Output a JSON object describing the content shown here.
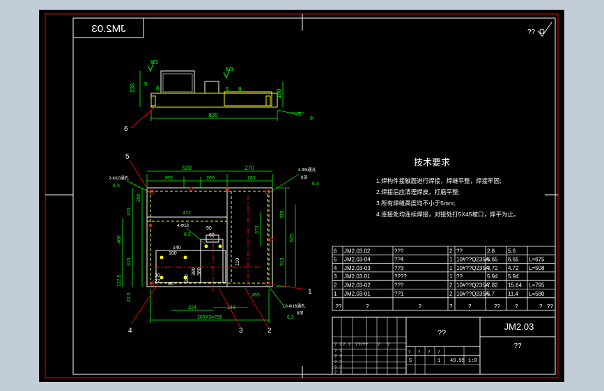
{
  "drawing_number": "JM2.03",
  "mirrored_number": "JM2.03",
  "roughness_mark": "??",
  "front_view": {
    "roughness": [
      "6.3",
      "6.3"
    ],
    "weld_marks": [
      "5",
      "5",
      "8",
      "8"
    ],
    "dims": {
      "width": "830",
      "height_left": "238",
      "height_right": "180"
    },
    "balloon": "6"
  },
  "plan_view": {
    "balloons": {
      "b5": "5",
      "b4": "4",
      "b3": "3",
      "b2": "2",
      "b1": "1"
    },
    "top_dims": {
      "overall1": "520",
      "overall2": "270",
      "seg1": "265",
      "seg2": "265",
      "seg3": "265"
    },
    "left_dims": {
      "d200": "200",
      "d315a": "315",
      "d400": "400",
      "d315b": "315",
      "d1225": "122.5",
      "d225": "22.5"
    },
    "right_dims": {
      "d370": "370",
      "d315a": "315",
      "d675": "675",
      "d315b": "315"
    },
    "inner_dims": {
      "d472": "472",
      "d90": "90",
      "d60": "60",
      "d140": "140",
      "d100": "100",
      "d110": "110",
      "d30": "30",
      "d27": "27",
      "d250": "250",
      "d380a": "380",
      "d380b": "380",
      "d80": "80"
    },
    "bottom_dims": {
      "d224": "224",
      "d248": "248",
      "d265": "265",
      "d2653": "265X3=795"
    },
    "callouts": {
      "holes_tl": "2-Φ10通孔",
      "holes_tr": "4-Φ8通孔",
      "holes_mid": "4-Φ18",
      "holes_br": "10-Φ16通孔",
      "depth": "8深",
      "rough": "6.3"
    }
  },
  "tech_req": {
    "title": "技术要求",
    "lines": [
      "1.焊构件接触面进行焊接，焊缝平整，焊接牢固;",
      "2.焊接后应清理焊皮，打磨平整;",
      "3.所有焊缝高度均不小于5mm;",
      "4.连接处均连续焊接，对接处打5X45坡口，焊平为止。"
    ]
  },
  "bom": [
    {
      "no": "6",
      "code": "JM2.03.02",
      "name": "???",
      "qty": "2",
      "mat": "??",
      "w1": "2.8",
      "w2": "5.6",
      "note": ""
    },
    {
      "no": "5",
      "code": "JM2.03-04",
      "name": "??4",
      "qty": "1",
      "mat": "10#??Q235A",
      "w1": "6.65",
      "w2": "6.65",
      "note": "L=675"
    },
    {
      "no": "4",
      "code": "JM2.03-03",
      "name": "??3",
      "qty": "1",
      "mat": "10#??Q235A",
      "w1": "4.72",
      "w2": "4.72",
      "note": "L=508"
    },
    {
      "no": "3",
      "code": "JM2.03.01",
      "name": "????",
      "qty": "1",
      "mat": "??",
      "w1": "5.94",
      "w2": "5.94",
      "note": ""
    },
    {
      "no": "2",
      "code": "JM2.03-02",
      "name": "???",
      "qty": "2",
      "mat": "10#??Q235A",
      "w1": "7.82",
      "w2": "15.64",
      "note": "L=795"
    },
    {
      "no": "1",
      "code": "JM2.03-01",
      "name": "??1",
      "qty": "2",
      "mat": "10#??Q235A",
      "w1": "5.7",
      "w2": "11.4",
      "note": "L=580"
    }
  ],
  "bom_header": [
    "??",
    "?",
    "?",
    "?",
    "?",
    "??",
    "?",
    "?",
    "??"
  ],
  "title_block": {
    "name": "??",
    "code": "JM2.03",
    "company": "??",
    "scale_row": [
      "S",
      "1",
      "49.95",
      "1:8"
    ],
    "sign_labels": [
      "?",
      "?",
      "?????",
      "?",
      "?",
      "?",
      "?",
      "?",
      "?"
    ],
    "grid_labels": [
      "? ?",
      "? ?",
      "? ?",
      "? ?",
      "? ?",
      "? ?"
    ]
  }
}
